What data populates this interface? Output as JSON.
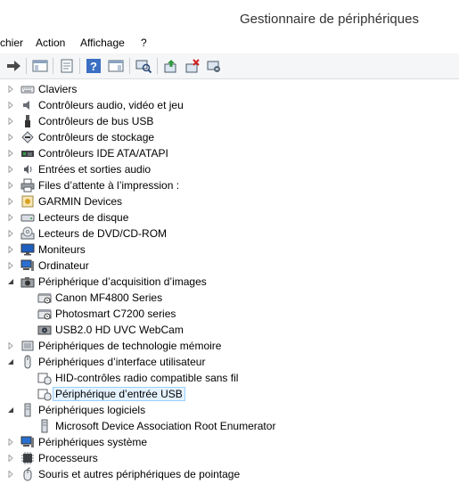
{
  "window": {
    "title": "Gestionnaire de périphériques"
  },
  "menubar": {
    "items": [
      "chier",
      "Action",
      "Affichage",
      "?"
    ]
  },
  "toolbar": {
    "buttons": [
      {
        "name": "forward-icon"
      },
      {
        "name": "show-hide-console-tree-icon"
      },
      {
        "name": "properties-icon"
      },
      {
        "name": "help-icon"
      },
      {
        "name": "action-pane-icon"
      },
      {
        "name": "scan-hardware-icon"
      },
      {
        "name": "update-driver-icon"
      },
      {
        "name": "uninstall-icon"
      },
      {
        "name": "disable-device-icon"
      }
    ]
  },
  "tree": {
    "nodes": [
      {
        "label": "Claviers",
        "level": 0,
        "expanded": false,
        "icon": "keyboard-icon"
      },
      {
        "label": "Contrôleurs audio, vidéo et jeu",
        "level": 0,
        "expanded": false,
        "icon": "speaker-icon"
      },
      {
        "label": "Contrôleurs de bus USB",
        "level": 0,
        "expanded": false,
        "icon": "usb-icon"
      },
      {
        "label": "Contrôleurs de stockage",
        "level": 0,
        "expanded": false,
        "icon": "storage-controller-icon"
      },
      {
        "label": "Contrôleurs IDE ATA/ATAPI",
        "level": 0,
        "expanded": false,
        "icon": "ide-icon"
      },
      {
        "label": "Entrées et sorties audio",
        "level": 0,
        "expanded": false,
        "icon": "audio-io-icon"
      },
      {
        "label": "Files d’attente à l’impression :",
        "level": 0,
        "expanded": false,
        "icon": "printer-queue-icon"
      },
      {
        "label": "GARMIN Devices",
        "level": 0,
        "expanded": false,
        "icon": "garmin-device-icon"
      },
      {
        "label": "Lecteurs de disque",
        "level": 0,
        "expanded": false,
        "icon": "disk-drive-icon"
      },
      {
        "label": "Lecteurs de DVD/CD-ROM",
        "level": 0,
        "expanded": false,
        "icon": "dvd-drive-icon"
      },
      {
        "label": "Moniteurs",
        "level": 0,
        "expanded": false,
        "icon": "monitor-icon"
      },
      {
        "label": "Ordinateur",
        "level": 0,
        "expanded": false,
        "icon": "computer-icon"
      },
      {
        "label": "Périphérique d’acquisition d’images",
        "level": 0,
        "expanded": true,
        "icon": "imaging-device-icon"
      },
      {
        "label": "Canon MF4800 Series",
        "level": 1,
        "icon": "scanner-icon"
      },
      {
        "label": "Photosmart C7200 series",
        "level": 1,
        "icon": "scanner-icon"
      },
      {
        "label": "USB2.0 HD UVC WebCam",
        "level": 1,
        "icon": "webcam-icon"
      },
      {
        "label": "Périphériques de technologie mémoire",
        "level": 0,
        "expanded": false,
        "icon": "memory-device-icon"
      },
      {
        "label": "Périphériques d’interface utilisateur",
        "level": 0,
        "expanded": true,
        "icon": "hid-icon"
      },
      {
        "label": "HID-contrôles radio compatible sans fil",
        "level": 1,
        "icon": "hid-device-icon"
      },
      {
        "label": "Périphérique d’entrée USB",
        "level": 1,
        "icon": "hid-device-icon",
        "selected": true
      },
      {
        "label": "Périphériques logiciels",
        "level": 0,
        "expanded": true,
        "icon": "software-device-icon"
      },
      {
        "label": "Microsoft Device Association Root Enumerator",
        "level": 1,
        "icon": "software-device-icon"
      },
      {
        "label": "Périphériques système",
        "level": 0,
        "expanded": false,
        "icon": "system-device-icon"
      },
      {
        "label": "Processeurs",
        "level": 0,
        "expanded": false,
        "icon": "processor-icon"
      },
      {
        "label": "Souris et autres périphériques de pointage",
        "level": 0,
        "expanded": false,
        "icon": "mouse-icon"
      }
    ]
  }
}
